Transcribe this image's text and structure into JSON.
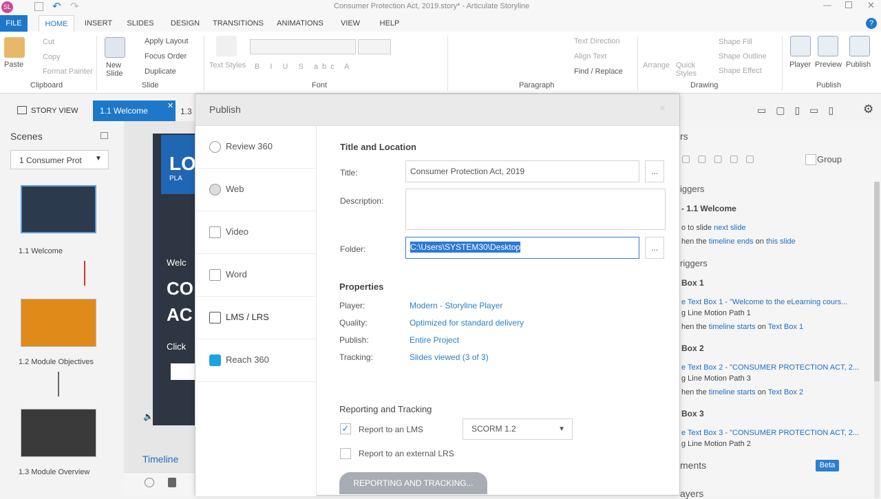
{
  "app": {
    "title": "Consumer Protection Act, 2019.story* - Articulate Storyline",
    "logo": "SL"
  },
  "ribbon": {
    "tabs": [
      "FILE",
      "HOME",
      "INSERT",
      "SLIDES",
      "DESIGN",
      "TRANSITIONS",
      "ANIMATIONS",
      "VIEW",
      "HELP"
    ],
    "clipboard": {
      "paste": "Paste",
      "cut": "Cut",
      "copy": "Copy",
      "format_painter": "Format Painter",
      "group": "Clipboard"
    },
    "slide": {
      "new_slide": "New Slide",
      "apply_layout": "Apply Layout",
      "focus_order": "Focus Order",
      "duplicate": "Duplicate",
      "group": "Slide"
    },
    "font": {
      "text_styles": "Text Styles",
      "group": "Font"
    },
    "paragraph": {
      "text_direction": "Text Direction",
      "align_text": "Align Text",
      "find_replace": "Find / Replace",
      "group": "Paragraph"
    },
    "drawing": {
      "arrange": "Arrange",
      "quick_styles": "Quick Styles",
      "shape_fill": "Shape Fill",
      "shape_outline": "Shape Outline",
      "shape_effect": "Shape Effect",
      "group": "Drawing"
    },
    "publish": {
      "player": "Player",
      "preview": "Preview",
      "publish": "Publish",
      "group": "Publish"
    }
  },
  "storybar": {
    "story_view": "STORY VIEW",
    "tab1": "1.1 Welcome",
    "tab2": "1.3"
  },
  "scenes": {
    "title": "Scenes",
    "selector": "1 Consumer Prot",
    "slides": [
      "1.1 Welcome",
      "1.2 Module Objectives",
      "1.3 Module Overview"
    ]
  },
  "canvas": {
    "text1": "LO",
    "text2": "PLA",
    "text3": "Welc",
    "text4": "CO",
    "text5": "AC",
    "text6": "Click",
    "timeline": "Timeline"
  },
  "triggers": {
    "title": "rs",
    "group": "Group",
    "slide_triggers": "iggers",
    "welcome": "- 1.1 Welcome",
    "t1_pre": "o to slide ",
    "t1_link": "next slide",
    "t2_pre": "hen the ",
    "t2_link": "timeline ends",
    "t2_mid": " on ",
    "t2_link2": "this slide",
    "obj_triggers": "riggers",
    "box1": "Box 1",
    "box1_l1": "e Text Box 1 - \"Welcome to the eLearning cours...",
    "box1_l2": "g Line Motion Path 1",
    "box1_l3_pre": "hen the ",
    "box1_l3_link": "timeline starts",
    "box1_l3_mid": " on ",
    "box1_l3_link2": "Text Box 1",
    "box2": "Box 2",
    "box2_l1": "e Text Box 2 - \"CONSUMER PROTECTION ACT, 2...",
    "box2_l2": "g Line Motion Path 3",
    "box2_l3_pre": "hen the ",
    "box2_l3_link": "timeline starts",
    "box2_l3_mid": " on ",
    "box2_l3_link2": "Text Box 2",
    "box3": "Box 3",
    "box3_l1": "e Text Box 3 - \"CONSUMER PROTECTION ACT, 2...",
    "box3_l2": "g Line Motion Path 2",
    "comments": "ments",
    "beta": "Beta",
    "layers": "ayers"
  },
  "dialog": {
    "title": "Publish",
    "close": "×",
    "nav": [
      "Review 360",
      "Web",
      "Video",
      "Word",
      "LMS / LRS",
      "Reach 360"
    ],
    "title_location": "Title and Location",
    "title_label": "Title:",
    "title_value": "Consumer Protection Act, 2019",
    "description_label": "Description:",
    "folder_label": "Folder:",
    "folder_value": "C:\\Users\\SYSTEM30\\Desktop",
    "browse": "...",
    "properties": "Properties",
    "player_label": "Player:",
    "player_value": "Modern - Storyline Player",
    "quality_label": "Quality:",
    "quality_value": "Optimized for standard delivery",
    "publish_label": "Publish:",
    "publish_value": "Entire Project",
    "tracking_label": "Tracking:",
    "tracking_value": "Slides viewed (3 of 3)",
    "reporting": "Reporting and Tracking",
    "report_lms": "Report to an LMS",
    "lms_select": "SCORM 1.2",
    "report_lrs": "Report to an external LRS",
    "reporting_button": "REPORTING AND TRACKING..."
  }
}
